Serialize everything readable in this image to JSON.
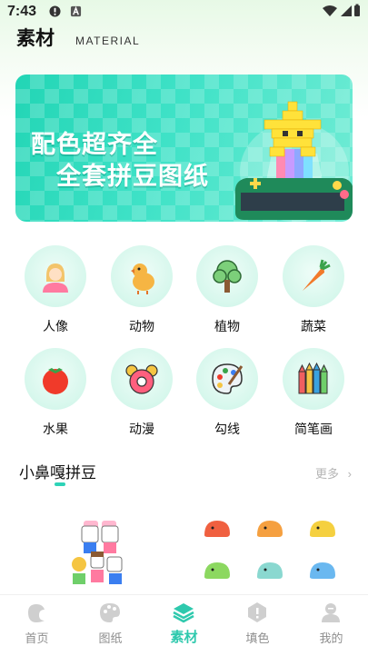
{
  "status": {
    "time": "7:43"
  },
  "header": {
    "title": "素材",
    "subtitle": "MATERIAL"
  },
  "banner": {
    "line1": "配色超齐全",
    "line2": "全套拼豆图纸"
  },
  "categories": [
    {
      "label": "人像",
      "icon": "portrait-icon"
    },
    {
      "label": "动物",
      "icon": "chick-icon"
    },
    {
      "label": "植物",
      "icon": "tree-icon"
    },
    {
      "label": "蔬菜",
      "icon": "carrot-icon"
    },
    {
      "label": "水果",
      "icon": "tomato-icon"
    },
    {
      "label": "动漫",
      "icon": "anime-face-icon"
    },
    {
      "label": "勾线",
      "icon": "palette-icon"
    },
    {
      "label": "简笔画",
      "icon": "crayons-icon"
    }
  ],
  "section": {
    "title": "小鼻嘎拼豆",
    "more": "更多"
  },
  "tabs": [
    {
      "label": "首页",
      "icon": "home-icon",
      "active": false
    },
    {
      "label": "图纸",
      "icon": "pattern-icon",
      "active": false
    },
    {
      "label": "素材",
      "icon": "material-icon",
      "active": true
    },
    {
      "label": "填色",
      "icon": "fill-icon",
      "active": false
    },
    {
      "label": "我的",
      "icon": "profile-icon",
      "active": false
    }
  ],
  "colors": {
    "accent": "#2ec9ad",
    "inactive": "#8e8e8e",
    "banner": "#22d5b5"
  }
}
